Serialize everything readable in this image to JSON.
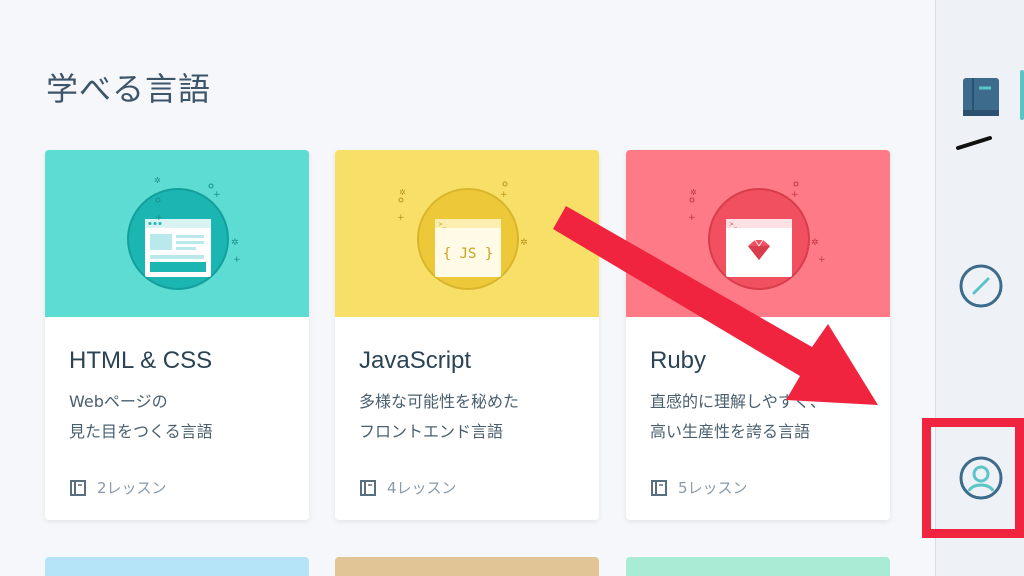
{
  "page": {
    "title": "学べる言語"
  },
  "courses": [
    {
      "name": "HTML & CSS",
      "desc_line1": "Webページの",
      "desc_line2": "見た目をつくる言語",
      "lessons": "2レッスン",
      "color": "#5ddcd4"
    },
    {
      "name": "JavaScript",
      "desc_line1": "多様な可能性を秘めた",
      "desc_line2": "フロントエンド言語",
      "lessons": "4レッスン",
      "color": "#f8e068"
    },
    {
      "name": "Ruby",
      "desc_line1": "直感的に理解しやすく、",
      "desc_line2": "高い生産性を誇る言語",
      "lessons": "5レッスン",
      "color": "#fe7a87"
    }
  ],
  "js_badge": "{ JS }",
  "peek_colors": [
    "#b5e4f8",
    "#e2c597",
    "#a9ecd5"
  ],
  "sidebar": {
    "items": [
      {
        "icon": "book-icon"
      },
      {
        "icon": "compass-icon"
      },
      {
        "icon": "user-profile-icon"
      }
    ],
    "accent": "#5bc4c7"
  },
  "annotation": {
    "color": "#f0243f"
  }
}
